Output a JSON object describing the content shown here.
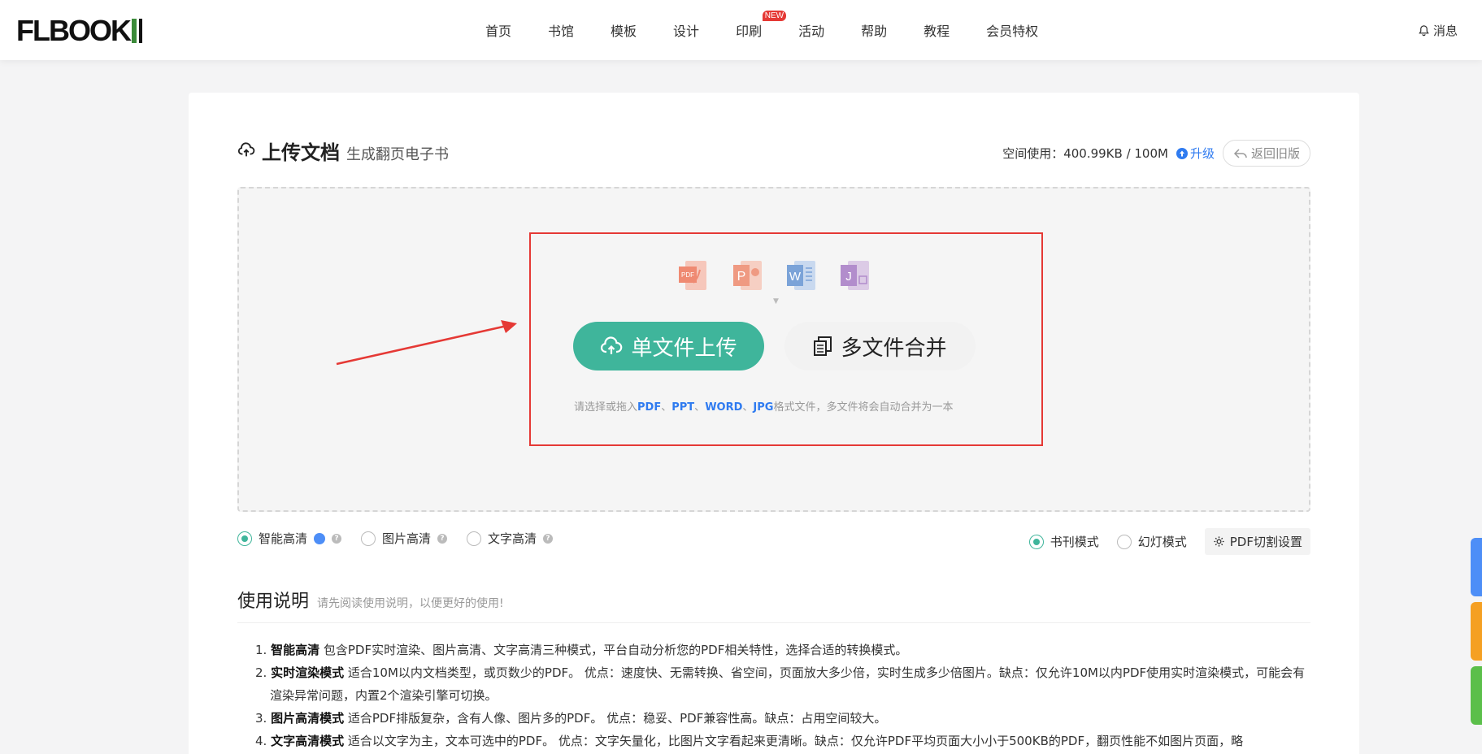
{
  "header": {
    "logo_text": "FLBOOK",
    "nav": [
      {
        "label": "首页"
      },
      {
        "label": "书馆"
      },
      {
        "label": "模板"
      },
      {
        "label": "设计"
      },
      {
        "label": "印刷",
        "badge": "NEW"
      },
      {
        "label": "活动"
      },
      {
        "label": "帮助"
      },
      {
        "label": "教程"
      },
      {
        "label": "会员特权"
      }
    ],
    "messages_label": "消息"
  },
  "upload": {
    "title": "上传文档",
    "subtitle": "生成翻页电子书",
    "space_label": "空间使用：400.99KB / 100M",
    "upgrade_label": "升级",
    "back_label": "返回旧版",
    "single_label": "单文件上传",
    "multi_label": "多文件合并",
    "hint_prefix": "请选择或拖入",
    "hint_types": [
      "PDF",
      "PPT",
      "WORD",
      "JPG"
    ],
    "hint_suffix": "格式文件，多文件将会自动合并为一本",
    "accent": "#3fb59b"
  },
  "options": {
    "quality": [
      {
        "label": "智能高清",
        "selected": true
      },
      {
        "label": "图片高清",
        "selected": false
      },
      {
        "label": "文字高清",
        "selected": false
      }
    ],
    "mode": [
      {
        "label": "书刊模式",
        "selected": true
      },
      {
        "label": "幻灯模式",
        "selected": false
      }
    ],
    "pdf_settings_label": "PDF切割设置"
  },
  "instructions": {
    "title": "使用说明",
    "subtitle": "请先阅读使用说明，以便更好的使用!",
    "items": [
      {
        "num": "1.",
        "head": "智能高清",
        "text": " 包含PDF实时渲染、图片高清、文字高清三种模式，平台自动分析您的PDF相关特性，选择合适的转换模式。"
      },
      {
        "num": "2.",
        "head": "实时渲染模式",
        "text": " 适合10M以内文档类型，或页数少的PDF。 优点：速度快、无需转换、省空间，页面放大多少倍，实时生成多少倍图片。缺点：仅允许10M以内PDF使用实时渲染模式，可能会有渲染异常问题，内置2个渲染引擎可切换。"
      },
      {
        "num": "3.",
        "head": "图片高清模式",
        "text": " 适合PDF排版复杂，含有人像、图片多的PDF。 优点：稳妥、PDF兼容性高。缺点：占用空间较大。"
      },
      {
        "num": "4.",
        "head": "文字高清模式",
        "text": " 适合以文字为主，文本可选中的PDF。 优点：文字矢量化，比图片文字看起来更清晰。缺点：仅允许PDF平均页面大小小于500KB的PDF，翻页性能不如图片页面，略"
      }
    ]
  }
}
